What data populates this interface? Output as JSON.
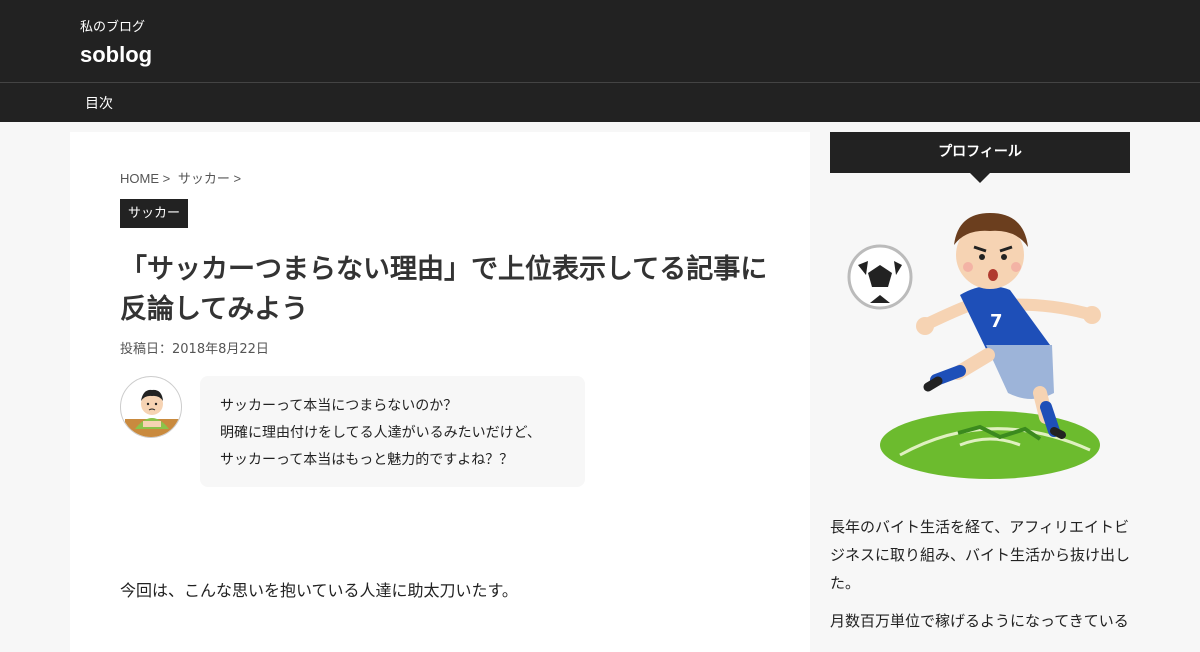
{
  "header": {
    "tagline": "私のブログ",
    "site_title": "soblog"
  },
  "nav": {
    "items": [
      {
        "label": "目次"
      }
    ]
  },
  "article": {
    "breadcrumb": [
      "HOME >",
      "サッカー >"
    ],
    "category": "サッカー",
    "title": "「サッカーつまらない理由」で上位表示してる記事に反論してみよう",
    "date": "投稿日：2018年8月22日",
    "bubble": [
      "サッカーって本当につまらないのか？",
      "明確に理由付けをしてる人達がいるみたいだけど、",
      "サッカーって本当はもっと魅力的ですよね？？"
    ],
    "intro": "今回は、こんな思いを抱いている人達に助太刀いたす。"
  },
  "sidebar": {
    "heading": "プロフィール",
    "paragraphs": [
      "長年のバイト生活を経て、アフィリエイトビジネスに取り組み、バイト生活から抜け出した。",
      "月数百万単位で稼げるようになってきている"
    ]
  },
  "colors": {
    "header_bg": "#222222",
    "page_bg": "#f7f7f7",
    "card_bg": "#ffffff",
    "accent": "#1e4fb8",
    "grass": "#6cbb2e"
  }
}
